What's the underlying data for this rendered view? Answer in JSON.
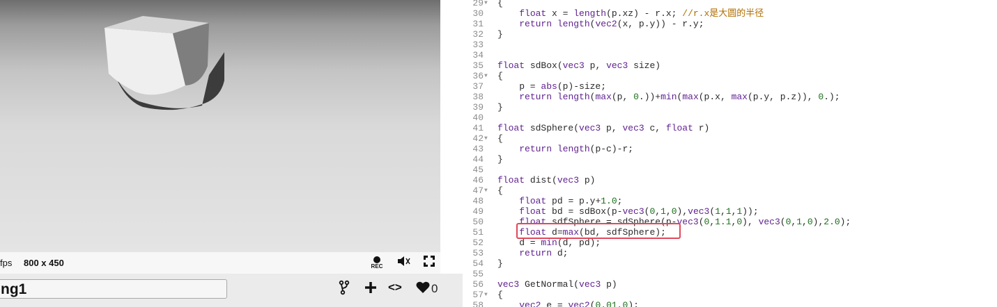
{
  "viewport": {
    "fps_label": "fps",
    "resolution": "800 x 450",
    "controls": {
      "rec_label": "REC",
      "volume_icon": "volume-icon",
      "fullscreen_icon": "fullscreen-icon"
    }
  },
  "shader": {
    "title": "ng1",
    "like_count": "0",
    "toolbar_icons": [
      "fork-icon",
      "plus-icon",
      "code-icon",
      "heart-icon"
    ],
    "code_symbol": "<>"
  },
  "editor": {
    "lines": [
      {
        "n": "29",
        "fold": true,
        "text": "{"
      },
      {
        "n": "30",
        "fold": false,
        "text": "    float x = length(p.xz) - r.x; //r.x是大圆的半径"
      },
      {
        "n": "31",
        "fold": false,
        "text": "    return length(vec2(x, p.y)) - r.y;"
      },
      {
        "n": "32",
        "fold": false,
        "text": "}"
      },
      {
        "n": "33",
        "fold": false,
        "text": ""
      },
      {
        "n": "34",
        "fold": false,
        "text": ""
      },
      {
        "n": "35",
        "fold": false,
        "text": "float sdBox(vec3 p, vec3 size)"
      },
      {
        "n": "36",
        "fold": true,
        "text": "{"
      },
      {
        "n": "37",
        "fold": false,
        "text": "    p = abs(p)-size;"
      },
      {
        "n": "38",
        "fold": false,
        "text": "    return length(max(p, 0.))+min(max(p.x, max(p.y, p.z)), 0.);"
      },
      {
        "n": "39",
        "fold": false,
        "text": "}"
      },
      {
        "n": "40",
        "fold": false,
        "text": ""
      },
      {
        "n": "41",
        "fold": false,
        "text": "float sdSphere(vec3 p, vec3 c, float r)"
      },
      {
        "n": "42",
        "fold": true,
        "text": "{"
      },
      {
        "n": "43",
        "fold": false,
        "text": "    return length(p-c)-r;"
      },
      {
        "n": "44",
        "fold": false,
        "text": "}"
      },
      {
        "n": "45",
        "fold": false,
        "text": ""
      },
      {
        "n": "46",
        "fold": false,
        "text": "float dist(vec3 p)"
      },
      {
        "n": "47",
        "fold": true,
        "text": "{"
      },
      {
        "n": "48",
        "fold": false,
        "text": "    float pd = p.y+1.0;"
      },
      {
        "n": "49",
        "fold": false,
        "text": "    float bd = sdBox(p-vec3(0,1,0),vec3(1,1,1));"
      },
      {
        "n": "50",
        "fold": false,
        "text": "    float sdfSphere = sdSphere(p-vec3(0,1.1,0), vec3(0,1,0),2.0);"
      },
      {
        "n": "51",
        "fold": false,
        "text": "    float d=max(bd, sdfSphere);"
      },
      {
        "n": "52",
        "fold": false,
        "text": "    d = min(d, pd);"
      },
      {
        "n": "53",
        "fold": false,
        "text": "    return d;"
      },
      {
        "n": "54",
        "fold": false,
        "text": "}"
      },
      {
        "n": "55",
        "fold": false,
        "text": ""
      },
      {
        "n": "56",
        "fold": false,
        "text": "vec3 GetNormal(vec3 p)"
      },
      {
        "n": "57",
        "fold": true,
        "text": "{"
      },
      {
        "n": "58",
        "fold": false,
        "text": "    vec2 e = vec2(0.01,0);"
      }
    ],
    "highlight_line": "51",
    "colors": {
      "keyword": "#5f1f8f",
      "number": "#1a6e1a",
      "comment": "#b06d00",
      "highlight": "#e0485a",
      "line_number": "#8c8c8c"
    }
  }
}
